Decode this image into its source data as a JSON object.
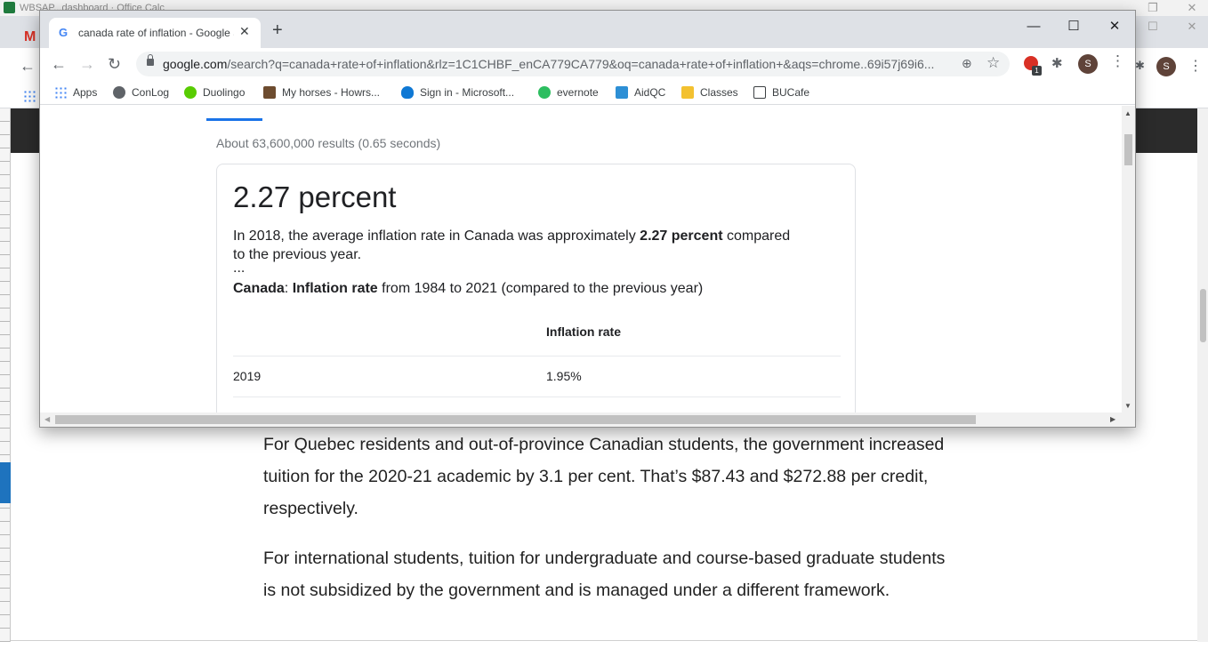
{
  "background_window": {
    "title": "WBSAP...dashboard · Office Calc",
    "article": {
      "paragraph1": "For Quebec residents and out-of-province Canadian students, the government increased tuition for the 2020-21 academic by 3.1 per cent. That’s $87.43 and $272.88 per credit, respectively.",
      "paragraph2": "For international students, tuition for undergraduate and course-based graduate students is not subsidized by the government and is managed under a different framework."
    },
    "avatar_letter": "S"
  },
  "browser": {
    "tab": {
      "title": "canada rate of inflation - Google Search",
      "favicon": "G"
    },
    "window_controls": {
      "minimize": "—",
      "maximize": "☐",
      "close": "✕"
    },
    "url": {
      "host": "google.com",
      "path": "/search?q=canada+rate+of+inflation&rlz=1C1CHBF_enCA779CA779&oq=canada+rate+of+inflation+&aqs=chrome..69i57j69i6..."
    },
    "extension_badge": "1",
    "avatar_letter": "S",
    "bookmarks": [
      {
        "label": "Apps",
        "icon": "apps-grid-icon"
      },
      {
        "label": "ConLog",
        "icon": "conlog-icon"
      },
      {
        "label": "Duolingo",
        "icon": "duolingo-icon"
      },
      {
        "label": "My horses - Howrs...",
        "icon": "horse-icon"
      },
      {
        "label": "Sign in - Microsoft...",
        "icon": "onedrive-icon"
      },
      {
        "label": "evernote",
        "icon": "evernote-icon"
      },
      {
        "label": "AidQC",
        "icon": "aidqc-icon"
      },
      {
        "label": "Classes",
        "icon": "classes-icon"
      },
      {
        "label": "BUCafe",
        "icon": "bucafe-icon"
      }
    ]
  },
  "search": {
    "result_stats": "About 63,600,000 results (0.65 seconds)",
    "featured": {
      "answer": "2.27 percent",
      "snippet_prefix": "In 2018, the average inflation rate in Canada was approximately ",
      "snippet_bold": "2.27 percent",
      "snippet_suffix": " compared to the previous year.",
      "ellipsis": "...",
      "subtitle_country": "Canada",
      "subtitle_sep": ": ",
      "subtitle_bold": "Inflation rate",
      "subtitle_rest": " from 1984 to 2021 (compared to the previous year)",
      "table": {
        "header_rate": "Inflation rate",
        "rows": [
          {
            "year": "2019",
            "rate": "1.95%"
          }
        ]
      }
    }
  }
}
